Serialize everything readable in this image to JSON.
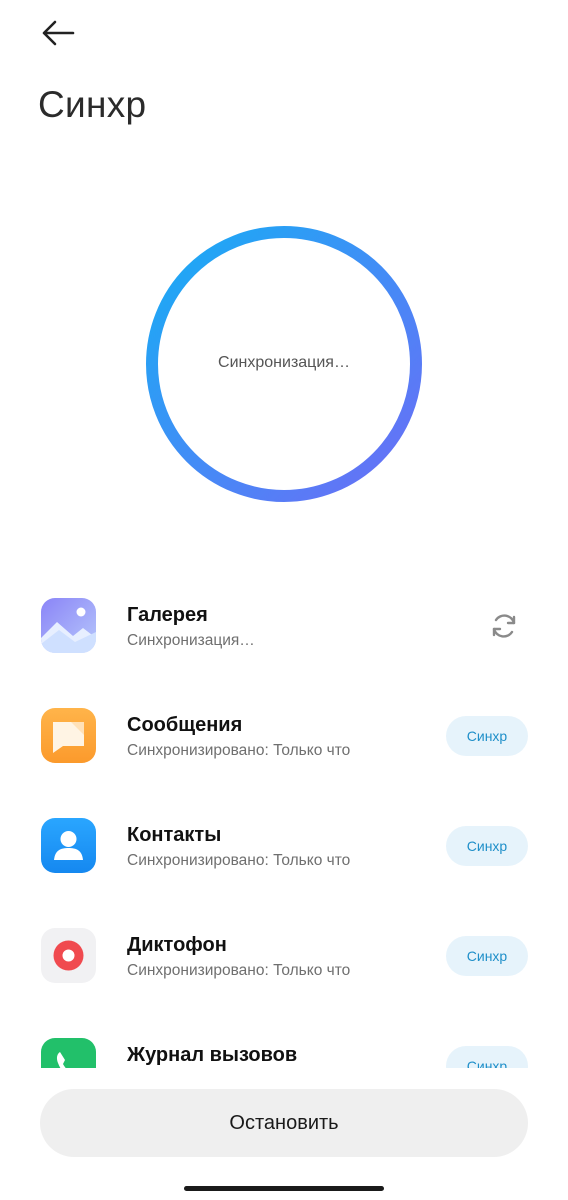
{
  "header": {
    "title": "Синхр"
  },
  "progress": {
    "status": "Синхронизация…"
  },
  "apps": [
    {
      "name": "Галерея",
      "status": "Синхронизация…",
      "action": ""
    },
    {
      "name": "Сообщения",
      "status": "Синхронизировано: Только что",
      "action": "Синхр"
    },
    {
      "name": "Контакты",
      "status": "Синхронизировано: Только что",
      "action": "Синхр"
    },
    {
      "name": "Диктофон",
      "status": "Синхронизировано: Только что",
      "action": "Синхр"
    },
    {
      "name": "Журнал вызовов",
      "status": "",
      "action": "Синхр"
    }
  ],
  "footer": {
    "stop_label": "Остановить"
  },
  "colors": {
    "ring_start": "#16aef5",
    "ring_end": "#6d6cf6",
    "sync_button_bg": "#e6f3fb",
    "sync_button_text": "#1f8fc9"
  },
  "icons": {
    "back": "arrow-left-icon",
    "gallery": "gallery-icon",
    "messages": "messages-icon",
    "contacts": "contacts-icon",
    "recorder": "recorder-icon",
    "call_log": "phone-icon",
    "syncing": "refresh-icon"
  }
}
